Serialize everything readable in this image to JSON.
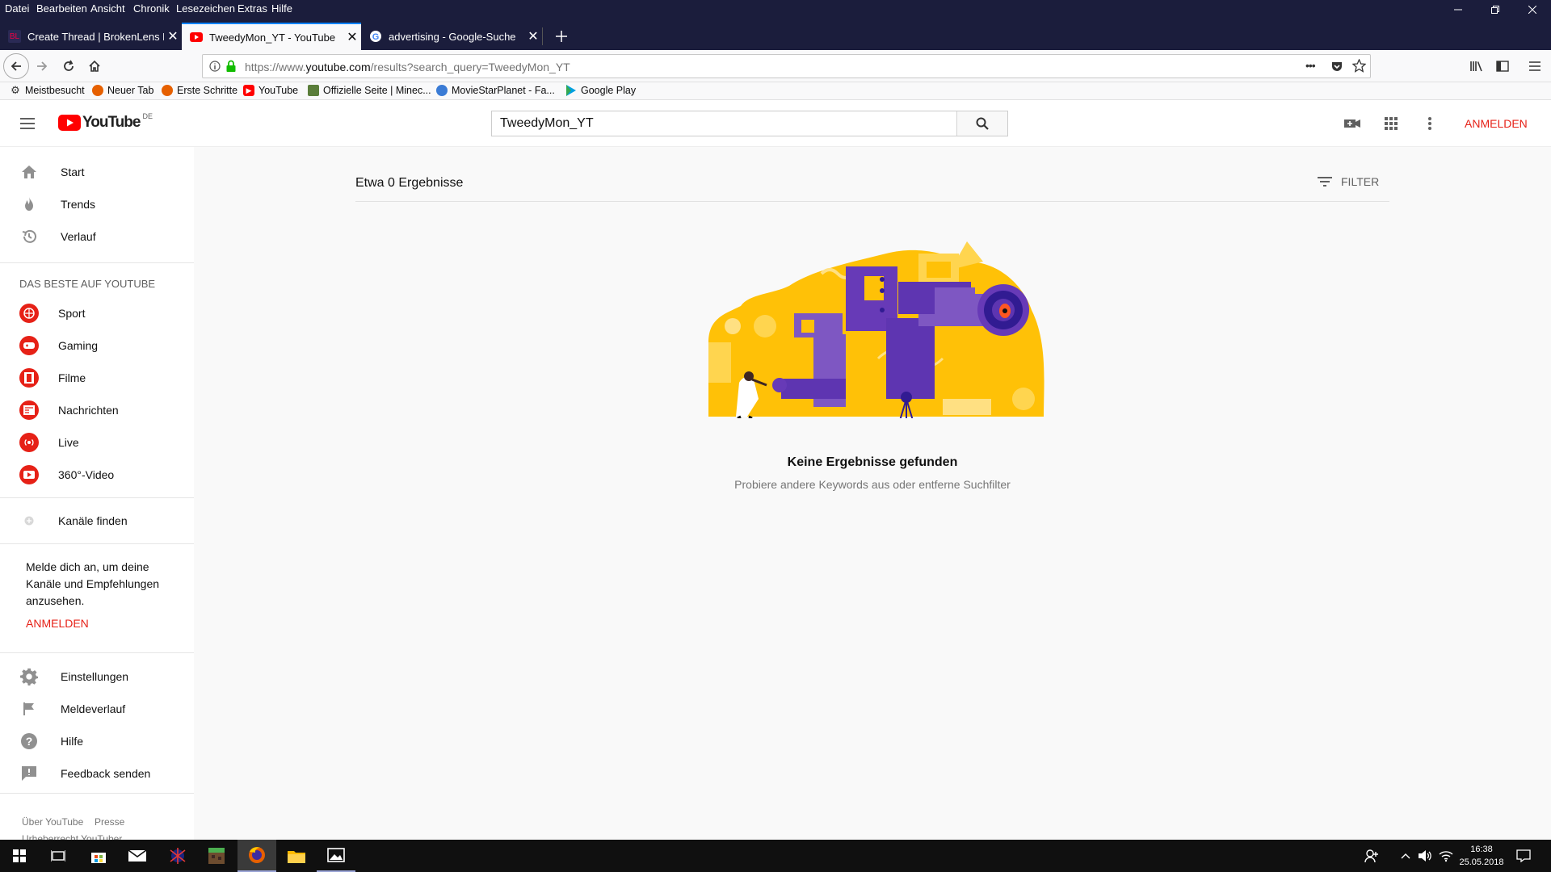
{
  "menubar": {
    "items": [
      "Datei",
      "Bearbeiten",
      "Ansicht",
      "Chronik",
      "Lesezeichen",
      "Extras",
      "Hilfe"
    ]
  },
  "tabs": [
    {
      "title": "Create Thread | BrokenLens Fo",
      "icon": "brokenlens-icon"
    },
    {
      "title": "TweedyMon_YT - YouTube",
      "icon": "youtube-icon",
      "active": true
    },
    {
      "title": "advertising - Google-Suche",
      "icon": "google-icon"
    }
  ],
  "navbar": {
    "url_prefix": "https://www.",
    "url_domain": "youtube.com",
    "url_path": "/results?search_query=TweedyMon_YT",
    "more": "•••"
  },
  "bookmarks": [
    "Meistbesucht",
    "Neuer Tab",
    "Erste Schritte",
    "YouTube",
    "Offizielle Seite | Minec...",
    "MovieStarPlanet - Fa...",
    "Google Play"
  ],
  "youtube": {
    "logo_text": "YouTube",
    "logo_region": "DE",
    "search_value": "TweedyMon_YT",
    "signin": "ANMELDEN",
    "brand_red": "#ff0000"
  },
  "sidebar": {
    "main": [
      {
        "label": "Start",
        "icon": "home-icon"
      },
      {
        "label": "Trends",
        "icon": "flame-icon"
      },
      {
        "label": "Verlauf",
        "icon": "history-icon"
      }
    ],
    "best_header": "DAS BESTE AUF YOUTUBE",
    "best": [
      {
        "label": "Sport",
        "icon": "sport-icon"
      },
      {
        "label": "Gaming",
        "icon": "gaming-icon"
      },
      {
        "label": "Filme",
        "icon": "film-icon"
      },
      {
        "label": "Nachrichten",
        "icon": "news-icon"
      },
      {
        "label": "Live",
        "icon": "live-icon"
      },
      {
        "label": "360°-Video",
        "icon": "video360-icon"
      }
    ],
    "find_channels": "Kanäle finden",
    "signin_prompt": "Melde dich an, um deine Kanäle und Empfehlungen anzusehen.",
    "signin_link": "ANMELDEN",
    "settings": [
      {
        "label": "Einstellungen",
        "icon": "gear-icon"
      },
      {
        "label": "Meldeverlauf",
        "icon": "flag-icon"
      },
      {
        "label": "Hilfe",
        "icon": "help-icon"
      },
      {
        "label": "Feedback senden",
        "icon": "feedback-icon"
      }
    ],
    "footer_links": [
      "Über YouTube",
      "Presse"
    ],
    "footer_cut": "Urheberrecht YouTuber"
  },
  "results": {
    "count_text": "Etwa 0 Ergebnisse",
    "filter": "FILTER",
    "empty_title": "Keine Ergebnisse gefunden",
    "empty_sub": "Probiere andere Keywords aus oder entferne Suchfilter"
  },
  "taskbar": {
    "time": "16:38",
    "date": "25.05.2018"
  }
}
